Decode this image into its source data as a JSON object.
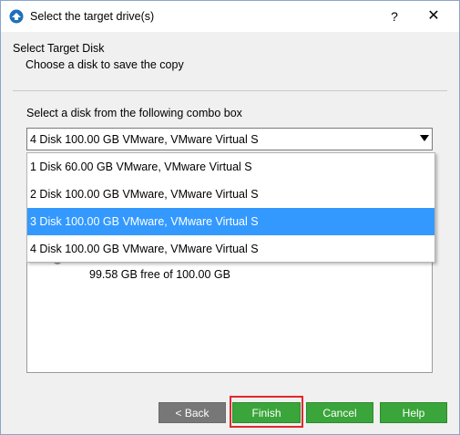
{
  "window": {
    "title": "Select the target drive(s)",
    "help_label": "?",
    "close_label": "✕"
  },
  "header": {
    "heading": "Select Target Disk",
    "subheading": "Choose a disk to save the copy"
  },
  "combo": {
    "label": "Select a disk from the following combo box",
    "selected": "4 Disk 100.00 GB VMware,  VMware Virtual S"
  },
  "dropdown": {
    "options": [
      "1 Disk 60.00 GB VMware,  VMware Virtual S",
      "2 Disk 100.00 GB VMware,  VMware Virtual S",
      "3 Disk 100.00 GB VMware,  VMware Virtual S",
      "4 Disk 100.00 GB VMware,  VMware Virtual S"
    ],
    "highlighted_index": 2
  },
  "disk_info": {
    "free_text": "99.58 GB free of 100.00 GB"
  },
  "buttons": {
    "back": "< Back",
    "finish": "Finish",
    "cancel": "Cancel",
    "help": "Help"
  },
  "colors": {
    "button_green": "#3aa53a",
    "button_gray": "#777777",
    "highlight_blue": "#3399ff",
    "annotation_red": "#e0282c"
  },
  "icons": {
    "app": "minitool-app-icon",
    "dropdown": "chevron-down-icon"
  }
}
